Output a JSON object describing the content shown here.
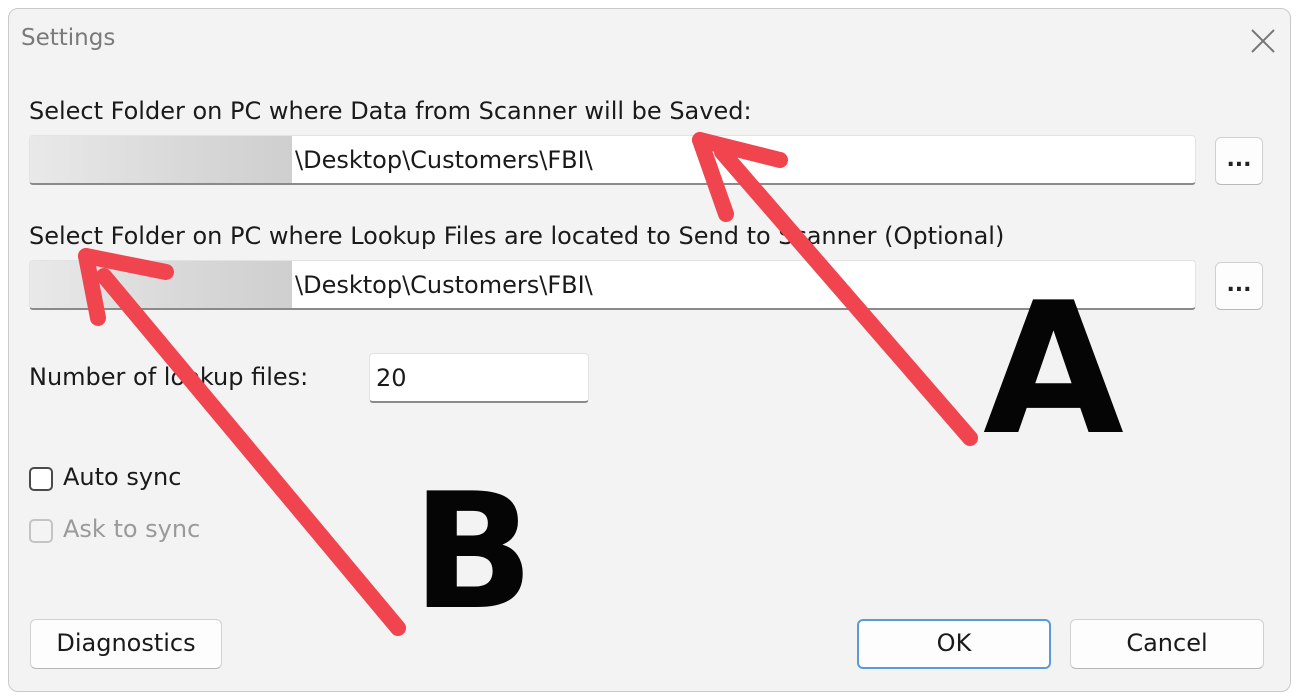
{
  "window": {
    "title": "Settings",
    "close_icon": "close-x-icon"
  },
  "data_folder": {
    "label": "Select Folder on PC where Data from Scanner will be Saved:",
    "path": "\\Desktop\\Customers\\FBI\\",
    "browse_label": "..."
  },
  "lookup_folder": {
    "label": "Select Folder on PC where Lookup Files are located to Send to Scanner (Optional)",
    "path": "\\Desktop\\Customers\\FBI\\",
    "browse_label": "..."
  },
  "lookup_count": {
    "label": "Number of lookup files:",
    "value": "20"
  },
  "auto_sync": {
    "label": "Auto sync",
    "checked": false
  },
  "ask_sync": {
    "label": "Ask to sync",
    "checked": false,
    "disabled": true
  },
  "buttons": {
    "diagnostics": "Diagnostics",
    "ok": "OK",
    "cancel": "Cancel"
  },
  "annotations": {
    "a": "A",
    "b": "B",
    "arrow_color": "#f0444f"
  }
}
